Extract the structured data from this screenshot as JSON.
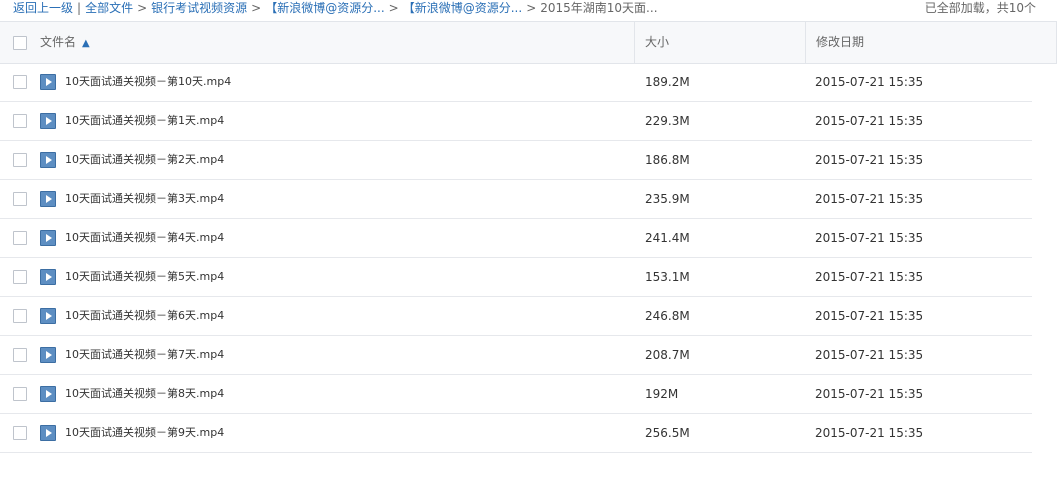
{
  "breadcrumb": {
    "back": "返回上一级",
    "sep1": "|",
    "all_files": "全部文件",
    "items": [
      "银行考试视频资源",
      "【新浪微博@资源分...",
      "【新浪微博@资源分..."
    ],
    "arrow": ">",
    "current": "2015年湖南10天面..."
  },
  "status": {
    "loaded": "已全部加载，共10个"
  },
  "table": {
    "headers": {
      "name": "文件名",
      "size": "大小",
      "date": "修改日期"
    },
    "sort_icon": "arrow-up-icon",
    "rows": [
      {
        "name": "10天面试通关视频－第10天.mp4",
        "size": "189.2M",
        "date": "2015-07-21 15:35"
      },
      {
        "name": "10天面试通关视频－第1天.mp4",
        "size": "229.3M",
        "date": "2015-07-21 15:35"
      },
      {
        "name": "10天面试通关视频－第2天.mp4",
        "size": "186.8M",
        "date": "2015-07-21 15:35"
      },
      {
        "name": "10天面试通关视频－第3天.mp4",
        "size": "235.9M",
        "date": "2015-07-21 15:35"
      },
      {
        "name": "10天面试通关视频－第4天.mp4",
        "size": "241.4M",
        "date": "2015-07-21 15:35"
      },
      {
        "name": "10天面试通关视频－第5天.mp4",
        "size": "153.1M",
        "date": "2015-07-21 15:35"
      },
      {
        "name": "10天面试通关视频－第6天.mp4",
        "size": "246.8M",
        "date": "2015-07-21 15:35"
      },
      {
        "name": "10天面试通关视频－第7天.mp4",
        "size": "208.7M",
        "date": "2015-07-21 15:35"
      },
      {
        "name": "10天面试通关视频－第8天.mp4",
        "size": "192M",
        "date": "2015-07-21 15:35"
      },
      {
        "name": "10天面试通关视频－第9天.mp4",
        "size": "256.5M",
        "date": "2015-07-21 15:35"
      }
    ]
  },
  "colors": {
    "link": "#2a6fb6",
    "file_icon": "#3c6ea3",
    "header_bg": "#f7f8fa"
  }
}
